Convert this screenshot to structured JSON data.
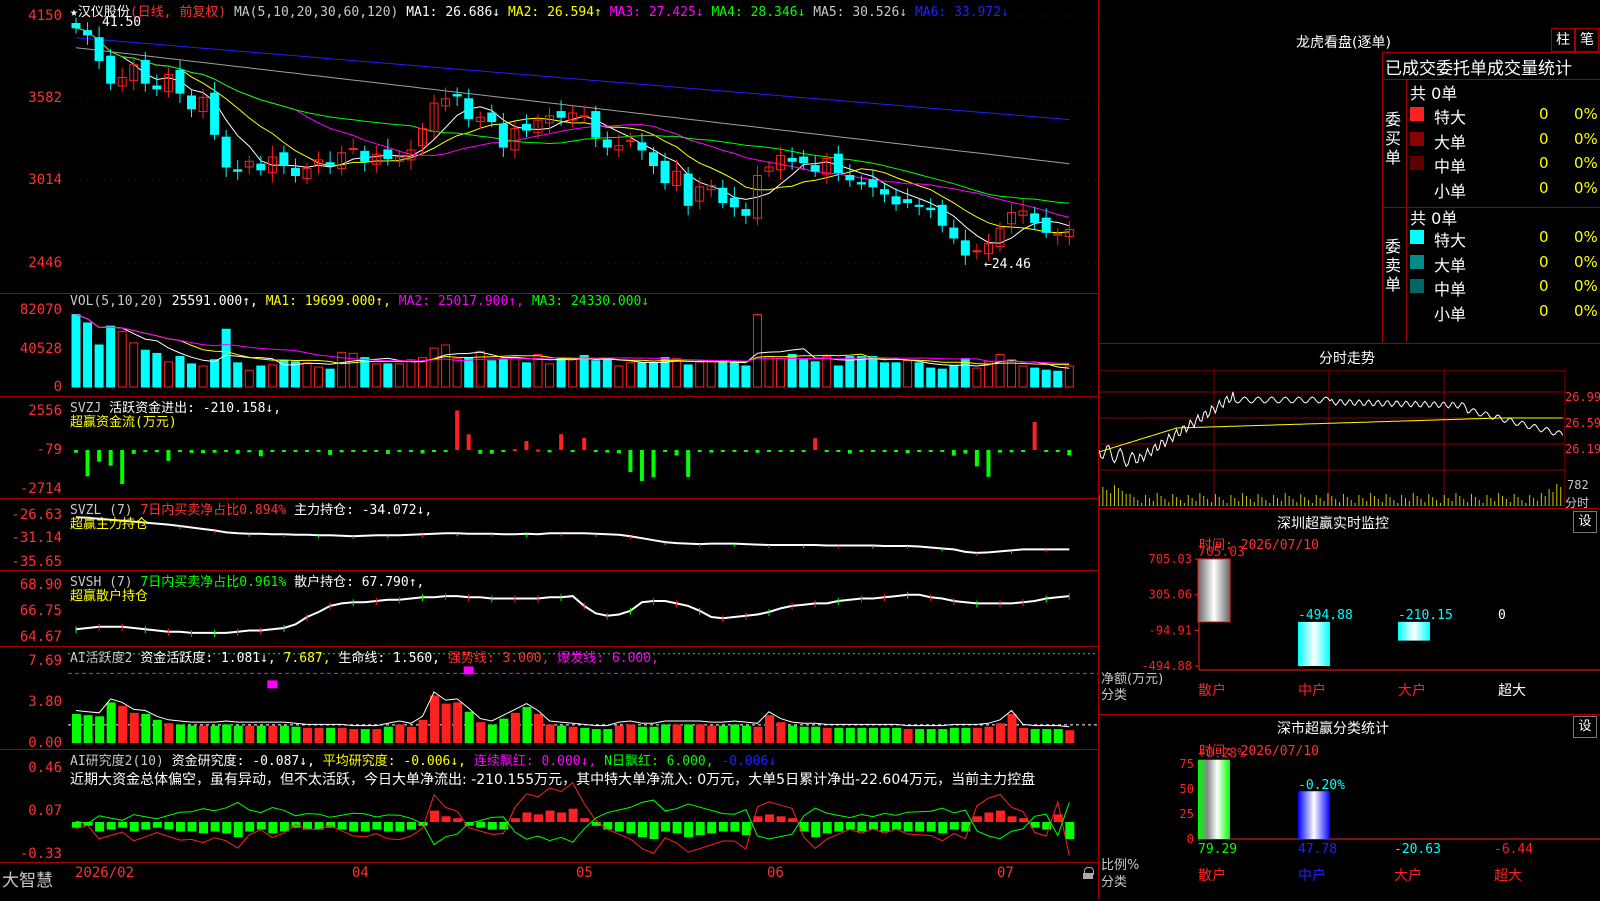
{
  "colors": {
    "up": "#ff2020",
    "down": "#00ffff",
    "bg": "#000000",
    "grid": "#a00000",
    "yellow": "#ffff00",
    "magenta": "#ff00ff",
    "green": "#00ff00",
    "white": "#ffffff",
    "blue": "#2020ff",
    "gray": "#a0a0a0"
  },
  "kline": {
    "star": "★",
    "stock": "汉仪股份",
    "mode": "(日线, 前复权)",
    "ma_params": "MA(5,10,20,30,60,120)",
    "ma1": "MA1: 26.686↓",
    "ma2": "MA2: 26.594↑",
    "ma3": "MA3: 27.425↓",
    "ma4": "MA4: 28.346↓",
    "ma5": "MA5: 30.526↓",
    "ma6": "MA6: 33.972↓",
    "y_labels": [
      "4150",
      "3582",
      "3014",
      "2446"
    ],
    "high_note": "41.50",
    "low_note": "←24.46",
    "chart_data": {
      "type": "candlestick",
      "title": "汉仪股份",
      "series": [
        {
          "name": "收盘",
          "values": [
            40.9,
            40.4,
            38.6,
            37.0,
            37.4,
            38.3,
            37.0,
            36.6,
            37.6,
            36.3,
            35.2,
            36.0,
            33.4,
            31.1,
            30.8,
            31.5,
            30.9,
            31.8,
            31.2,
            30.5,
            31.0,
            31.6,
            31.2,
            32.1,
            32.4,
            31.5,
            32.0,
            31.7,
            31.8,
            32.3,
            33.8,
            35.6,
            35.9,
            36.1,
            34.5,
            34.6,
            34.3,
            32.5,
            33.8,
            33.7,
            34.4,
            34.7,
            34.6,
            34.9,
            34.7,
            33.2,
            32.5,
            32.6,
            33.0,
            32.3,
            31.2,
            30.0,
            30.8,
            28.4,
            29.7,
            29.8,
            28.6,
            28.3,
            27.7,
            30.5,
            31.1,
            31.9,
            31.5,
            31.4,
            30.8,
            31.7,
            30.7,
            30.2,
            29.9,
            29.7,
            29.2,
            28.5,
            28.6,
            28.4,
            28.1,
            27.0,
            26.1,
            24.9,
            25.2,
            25.7,
            26.8,
            27.9,
            28.0,
            27.2,
            26.5,
            26.4,
            26.7
          ]
        }
      ]
    }
  },
  "vol": {
    "title": "VOL(5,10,20)",
    "val": "25591.000↑",
    "ma1": "MA1: 19699.000↑",
    "ma2": "MA2: 25017.900↑",
    "ma3": "MA3: 24330.000↓",
    "y_labels": [
      "82070",
      "40528",
      "0"
    ],
    "chart_data": {
      "type": "bar",
      "series": [
        {
          "name": "VOL",
          "values": [
            69,
            61,
            40,
            58,
            53,
            42,
            35,
            32,
            24,
            29,
            22,
            20,
            26,
            55,
            23,
            16,
            20,
            21,
            25,
            24,
            23,
            19,
            17,
            33,
            32,
            28,
            22,
            22,
            22,
            26,
            28,
            37,
            40,
            27,
            28,
            34,
            25,
            26,
            28,
            23,
            31,
            22,
            27,
            27,
            30,
            25,
            27,
            20,
            23,
            23,
            23,
            28,
            27,
            21,
            24,
            24,
            25,
            23,
            20,
            69,
            29,
            27,
            31,
            26,
            24,
            29,
            20,
            29,
            29,
            29,
            23,
            23,
            25,
            23,
            18,
            17,
            20,
            27,
            18,
            24,
            31,
            26,
            20,
            18,
            16,
            15,
            20
          ]
        }
      ]
    }
  },
  "svzj": {
    "title": "SVZJ",
    "label": "活跃资金进出: -210.158↓,",
    "sub": "超赢资金流(万元)",
    "y_labels": [
      "2556",
      "-79",
      "-2714"
    ],
    "chart_data": {
      "type": "bar",
      "series": [
        {
          "name": "活跃资金进出",
          "values": [
            -103,
            -1011,
            -450,
            -606,
            -1307,
            -148,
            -84,
            -86,
            -418,
            -63,
            -110,
            -121,
            -106,
            -58,
            -138,
            -87,
            -241,
            -39,
            -61,
            -65,
            -75,
            -53,
            -190,
            -88,
            -60,
            -76,
            -64,
            -151,
            -73,
            -46,
            -132,
            -63,
            -80,
            1522,
            605,
            -142,
            -141,
            -34,
            32,
            346,
            15,
            -90,
            610,
            -81,
            466,
            -74,
            -96,
            -133,
            -848,
            -1190,
            -1050,
            -53,
            -211,
            -1038,
            -57,
            -96,
            -74,
            -44,
            -57,
            -103,
            -59,
            -40,
            -71,
            -35,
            453,
            -70,
            -48,
            -138,
            -42,
            -34,
            -38,
            -32,
            -125,
            -57,
            -57,
            -76,
            -216,
            -137,
            -630,
            -1030,
            -98,
            -90,
            -69,
            1076,
            -62,
            -80,
            -210
          ]
        }
      ]
    }
  },
  "svzl": {
    "title": "SVZL (7)",
    "ratio": "7日内买卖净占比0.894%",
    "hold": "主力持仓: -34.072↓,",
    "sub": "超赢主力持仓",
    "y_labels": [
      "-26.63",
      "-31.14",
      "-35.65"
    ],
    "chart_data": {
      "type": "line",
      "series": [
        {
          "name": "主力持仓",
          "values": [
            -27.5,
            -27.6,
            -27.8,
            -28.0,
            -28.2,
            -28.4,
            -28.6,
            -28.8,
            -29.0,
            -29.3,
            -29.6,
            -29.9,
            -30.2,
            -30.6,
            -30.8,
            -30.9,
            -30.9,
            -31.0,
            -31.0,
            -31.1,
            -31.1,
            -31.2,
            -31.2,
            -31.3,
            -31.4,
            -31.3,
            -31.2,
            -31.2,
            -31.2,
            -31.1,
            -31.0,
            -30.9,
            -30.8,
            -30.8,
            -30.9,
            -30.9,
            -30.9,
            -31.0,
            -31.0,
            -30.9,
            -31.0,
            -30.8,
            -30.8,
            -30.8,
            -30.8,
            -30.9,
            -31.0,
            -31.1,
            -31.4,
            -31.8,
            -32.2,
            -32.6,
            -32.8,
            -32.9,
            -33.0,
            -32.9,
            -32.9,
            -32.9,
            -33.0,
            -33.1,
            -33.2,
            -33.2,
            -33.2,
            -33.2,
            -33.2,
            -33.3,
            -33.3,
            -33.3,
            -33.3,
            -33.3,
            -33.4,
            -33.4,
            -33.4,
            -33.5,
            -33.7,
            -33.9,
            -34.1,
            -34.6,
            -34.8,
            -34.7,
            -34.5,
            -34.3,
            -34.1,
            -34.1,
            -34.1,
            -34.1,
            -34.1
          ]
        }
      ]
    }
  },
  "svsh": {
    "title": "SVSH (7)",
    "ratio": "7日内买卖净占比0.961%",
    "hold": "散户持仓: 67.790↑,",
    "sub": "超赢散户持仓",
    "y_labels": [
      "68.90",
      "66.75",
      "64.67"
    ],
    "chart_data": {
      "type": "line",
      "series": [
        {
          "name": "散户持仓",
          "values": [
            65.3,
            65.4,
            65.5,
            65.5,
            65.5,
            65.4,
            65.3,
            65.2,
            65.1,
            65.1,
            65.0,
            65.0,
            65.0,
            65.0,
            65.1,
            65.2,
            65.2,
            65.3,
            65.4,
            65.7,
            66.3,
            66.7,
            67.2,
            67.4,
            67.5,
            67.5,
            67.6,
            67.7,
            67.7,
            67.8,
            67.9,
            67.9,
            68.0,
            68.0,
            67.9,
            67.9,
            67.8,
            67.8,
            67.8,
            67.8,
            67.8,
            67.9,
            67.9,
            68.0,
            67.2,
            66.6,
            66.4,
            66.5,
            66.8,
            67.5,
            67.6,
            67.6,
            67.4,
            67.2,
            66.8,
            66.3,
            66.2,
            66.3,
            66.4,
            66.5,
            66.7,
            67.0,
            67.2,
            67.3,
            67.4,
            67.4,
            67.6,
            67.7,
            67.8,
            67.8,
            67.9,
            68.0,
            68.1,
            68.1,
            67.9,
            67.8,
            67.6,
            67.5,
            67.4,
            67.4,
            67.4,
            67.4,
            67.5,
            67.6,
            67.8,
            67.9,
            68.0
          ]
        }
      ]
    }
  },
  "ai_act": {
    "title": "AI活跃度2",
    "cap": "资金活跃度: 1.081↓,",
    "v2": "7.687,",
    "life": "生命线: 1.560,",
    "strong": "强势线: 3.000,",
    "burst": "爆发线: 6.000,",
    "y_labels": [
      "7.69",
      "3.80",
      "0.00"
    ],
    "chart_data": {
      "type": "bar",
      "series": [
        {
          "name": "资金活跃度",
          "values": [
            2.5,
            2.4,
            2.3,
            3.5,
            3.2,
            2.6,
            2.5,
            2.0,
            1.7,
            1.6,
            1.5,
            1.5,
            1.5,
            1.6,
            1.5,
            1.5,
            1.5,
            1.5,
            1.5,
            1.4,
            1.3,
            1.3,
            1.3,
            1.3,
            1.2,
            1.2,
            1.2,
            1.4,
            1.6,
            1.4,
            2.0,
            4.1,
            3.4,
            3.5,
            2.7,
            1.8,
            1.6,
            2.1,
            2.6,
            3.1,
            2.5,
            1.6,
            1.5,
            1.4,
            1.3,
            1.2,
            1.2,
            1.5,
            1.6,
            1.4,
            1.4,
            1.6,
            1.6,
            1.6,
            1.6,
            1.5,
            1.5,
            1.6,
            1.5,
            1.4,
            2.4,
            1.8,
            1.5,
            1.4,
            1.4,
            1.3,
            1.3,
            1.3,
            1.3,
            1.3,
            1.3,
            1.3,
            1.2,
            1.2,
            1.2,
            1.2,
            1.3,
            1.3,
            1.3,
            1.4,
            1.7,
            2.5,
            1.3,
            1.2,
            1.2,
            1.2,
            1.1
          ]
        }
      ]
    }
  },
  "ai_res": {
    "title": "AI研究度2(10)",
    "res": "资金研究度: -0.087↓,",
    "avg": "平均研究度: -0.006↓,",
    "red": "连续飘红: 0.000↓,",
    "nred": "N日飘红: 6.000,",
    "nred2": "-0.006↓",
    "text": "近期大资金总体偏空，虽有异动，但不太活跃，今日大单净流出: -210.155万元，其中特大单净流入: 0万元，大单5日累计净出-22.604万元，当前主力控盘",
    "y_labels": [
      "0.46",
      "0.07",
      "-0.33"
    ],
    "chart_data": {
      "type": "bar",
      "series": [
        {
          "name": "资金研究度",
          "values": [
            -0.03,
            -0.02,
            -0.05,
            -0.04,
            -0.03,
            -0.05,
            -0.04,
            -0.03,
            -0.04,
            -0.05,
            -0.05,
            -0.06,
            -0.05,
            -0.06,
            -0.08,
            -0.05,
            -0.04,
            -0.06,
            -0.05,
            -0.03,
            -0.04,
            -0.04,
            -0.03,
            -0.04,
            -0.05,
            -0.05,
            -0.04,
            -0.05,
            -0.05,
            -0.04,
            -0.02,
            0.06,
            0.03,
            0.02,
            -0.02,
            -0.03,
            -0.04,
            -0.04,
            0.02,
            0.05,
            0.04,
            0.06,
            0.05,
            0.07,
            0.02,
            -0.02,
            -0.04,
            -0.05,
            -0.06,
            -0.08,
            -0.09,
            -0.05,
            -0.06,
            -0.08,
            -0.07,
            -0.06,
            -0.05,
            -0.05,
            -0.07,
            0.03,
            0.04,
            0.03,
            0.02,
            -0.05,
            -0.08,
            -0.06,
            -0.05,
            -0.04,
            -0.05,
            -0.04,
            -0.05,
            -0.04,
            -0.05,
            -0.05,
            -0.05,
            -0.06,
            -0.04,
            -0.05,
            0.03,
            0.05,
            0.06,
            0.03,
            0.02,
            -0.03,
            -0.04,
            0.04,
            -0.09
          ]
        }
      ]
    }
  },
  "dates": [
    "2026/02",
    "04",
    "05",
    "06",
    "07"
  ],
  "brand": "大智慧",
  "right": {
    "dragon_title": "龙虎看盘(逐单)",
    "btn_zhu": "柱",
    "btn_bi": "笔",
    "stats_title": "已成交委托单成交量统计",
    "buy_vlabel": "委买单",
    "sell_vlabel": "委卖单",
    "buy_total": "共 0单",
    "sell_total": "共 0单",
    "buy_rows": [
      {
        "name": "特大",
        "count": "0",
        "pct": "0%"
      },
      {
        "name": "大单",
        "count": "0",
        "pct": "0%"
      },
      {
        "name": "中单",
        "count": "0",
        "pct": "0%"
      },
      {
        "name": "小单",
        "count": "0",
        "pct": "0%"
      }
    ],
    "sell_rows": [
      {
        "name": "特大",
        "count": "0",
        "pct": "0%"
      },
      {
        "name": "大单",
        "count": "0",
        "pct": "0%"
      },
      {
        "name": "中单",
        "count": "0",
        "pct": "0%"
      },
      {
        "name": "小单",
        "count": "0",
        "pct": "0%"
      }
    ],
    "intraday_title": "分时走势",
    "intraday_prices": [
      "26.99",
      "26.59",
      "26.19"
    ],
    "intraday_vol": "782",
    "intraday_unit": "分时",
    "monitor_title": "深圳超赢实时监控",
    "monitor_btn": "设",
    "monitor_time": "时间: 2026/07/10",
    "monitor_y": [
      "705.03",
      "305.06",
      "-94.91",
      "-494.88"
    ],
    "monitor_ylabel": "净额(万元)",
    "monitor_xcap": "分类",
    "monitor_values": [
      "705.03",
      "-494.88",
      "-210.15",
      "0"
    ],
    "monitor_cats": [
      "散户",
      "中户",
      "大户",
      "超大"
    ],
    "class_title": "深市超赢分类统计",
    "class_btn": "设",
    "class_time": "时间: 2026/07/10",
    "class_y": [
      "75",
      "50",
      "25",
      "0"
    ],
    "class_ylabel": "比例%",
    "class_xcap": "分类",
    "class_top": [
      "+0.28%",
      "-0.20%"
    ],
    "class_bottom": [
      "79.29",
      "47.78",
      "-20.63",
      "-6.44"
    ],
    "class_cats": [
      "散户",
      "中户",
      "大户",
      "超大"
    ]
  }
}
